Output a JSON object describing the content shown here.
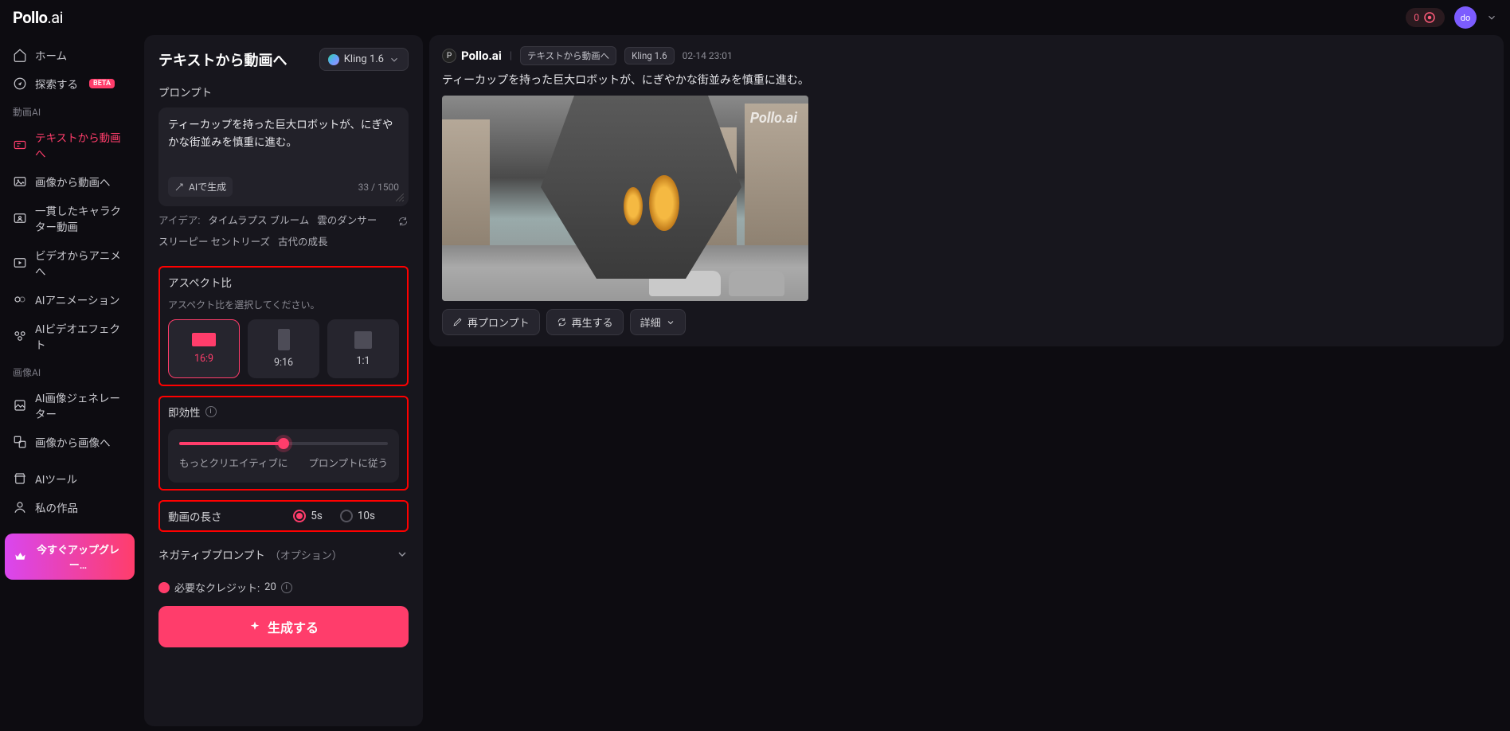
{
  "brand": {
    "name": "Pollo",
    "suffix": ".ai"
  },
  "top": {
    "credits": "0",
    "avatar": "do"
  },
  "sidebar": {
    "home": "ホーム",
    "explore": "探索する",
    "explore_badge": "BETA",
    "section_video": "動画AI",
    "items_video": [
      "テキストから動画へ",
      "画像から動画へ",
      "一貫したキャラクター動画",
      "ビデオからアニメへ",
      "AIアニメーション",
      "AIビデオエフェクト"
    ],
    "section_image": "画像AI",
    "items_image": [
      "AI画像ジェネレーター",
      "画像から画像へ"
    ],
    "tools": "AIツール",
    "works": "私の作品",
    "upgrade": "今すぐアップグレー…"
  },
  "panel": {
    "title": "テキストから動画へ",
    "model": "Kling 1.6",
    "prompt_label": "プロンプト",
    "prompt_value": "ティーカップを持った巨大ロボットが、にぎやかな街並みを慎重に進む。",
    "ai_generate": "AIで生成",
    "char_count": "33 / 1500",
    "ideas_label": "アイデア:",
    "ideas": [
      "タイムラプス ブルーム",
      "雲のダンサー",
      "スリーピー セントリーズ",
      "古代の成長"
    ],
    "aspect": {
      "title": "アスペクト比",
      "sub": "アスペクト比を選択してください。",
      "opts": [
        "16:9",
        "9:16",
        "1:1"
      ]
    },
    "relevance": {
      "title": "即効性",
      "left": "もっとクリエイティブに",
      "right": "プロンプトに従う"
    },
    "length": {
      "title": "動画の長さ",
      "opt5": "5s",
      "opt10": "10s"
    },
    "neg": {
      "title": "ネガティブプロンプト",
      "opt": "（オプション）"
    },
    "credits": {
      "label": "必要なクレジット:",
      "value": "20"
    },
    "generate": "生成する"
  },
  "card": {
    "brand": "Pollo.ai",
    "tag1": "テキストから動画へ",
    "tag2": "Kling 1.6",
    "timestamp": "02-14 23:01",
    "prompt": "ティーカップを持った巨大ロボットが、にぎやかな街並みを慎重に進む。",
    "watermark": "Pollo.ai",
    "reprompt": "再プロンプト",
    "regen": "再生する",
    "detail": "詳細"
  }
}
